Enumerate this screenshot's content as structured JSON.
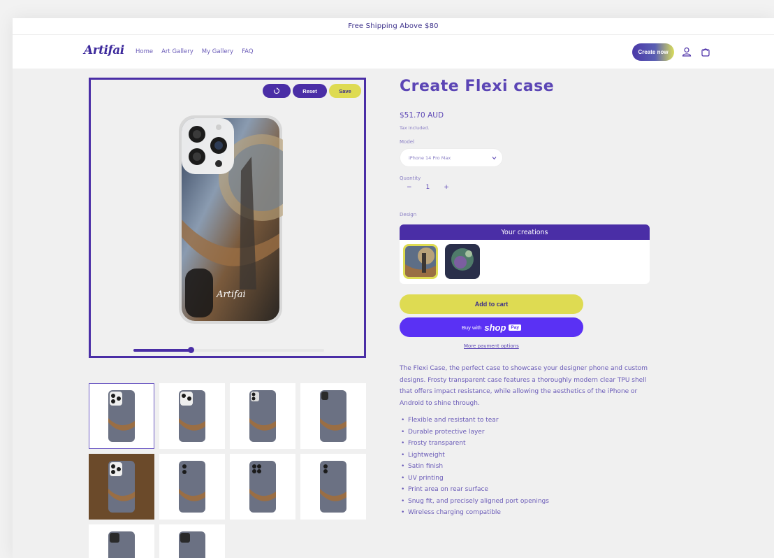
{
  "announcement": "Free Shipping Above $80",
  "header": {
    "logo": "Artifai",
    "nav": [
      "Home",
      "Art Gallery",
      "My Gallery",
      "FAQ"
    ],
    "create_now": "Create now"
  },
  "editor": {
    "rotate_icon": "rotate-icon",
    "reset_label": "Reset",
    "save_label": "Save",
    "zoom_level": 0.3,
    "case_signature": "Artifai"
  },
  "product": {
    "title": "Create Flexi case",
    "price": "$51.70 AUD",
    "tax_note": "Tax included.",
    "model_label": "Model",
    "model_value": "iPhone 14 Pro Max",
    "quantity_label": "Quantity",
    "quantity_value": "1",
    "qty_minus": "−",
    "qty_plus": "+",
    "design_label": "Design",
    "creations_header": "Your creations",
    "add_to_cart": "Add to cart",
    "buy_with": "Buy with",
    "shop": "shop",
    "pay": "Pay",
    "more_payment": "More payment options",
    "description": "The Flexi Case, the perfect case to showcase your designer phone and custom designs. Frosty transparent case features a thoroughly modern clear TPU shell that offers impact resistance, while allowing the aesthetics of the iPhone or Android to shine through.",
    "features": [
      "Flexible and resistant to tear",
      "Durable protective layer",
      "Frosty transparent",
      "Lightweight",
      "Satin finish",
      "UV printing",
      "Print area on rear surface",
      "Snug fit, and precisely aligned port openings",
      "Wireless charging compatible"
    ]
  },
  "colors": {
    "brand_purple": "#4a2ea6",
    "accent_yellow": "#dedb52",
    "shoppay": "#5a31f4"
  }
}
